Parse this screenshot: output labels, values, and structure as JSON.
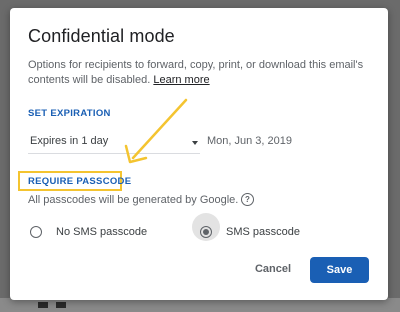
{
  "dialog": {
    "title": "Confidential mode",
    "description": "Options for recipients to forward, copy, print, or download this email's contents will be disabled.",
    "learn_more": "Learn more"
  },
  "expiration": {
    "section_label": "SET EXPIRATION",
    "selected": "Expires in 1 day",
    "date": "Mon, Jun 3, 2019"
  },
  "passcode": {
    "section_label": "REQUIRE PASSCODE",
    "note": "All passcodes will be generated by Google.",
    "options": [
      {
        "label": "No SMS passcode",
        "checked": false
      },
      {
        "label": "SMS passcode",
        "checked": true
      }
    ]
  },
  "actions": {
    "cancel": "Cancel",
    "save": "Save"
  },
  "colors": {
    "accent": "#1a5fb4",
    "annotation": "#f4c430"
  },
  "icons": {
    "help": "?"
  }
}
